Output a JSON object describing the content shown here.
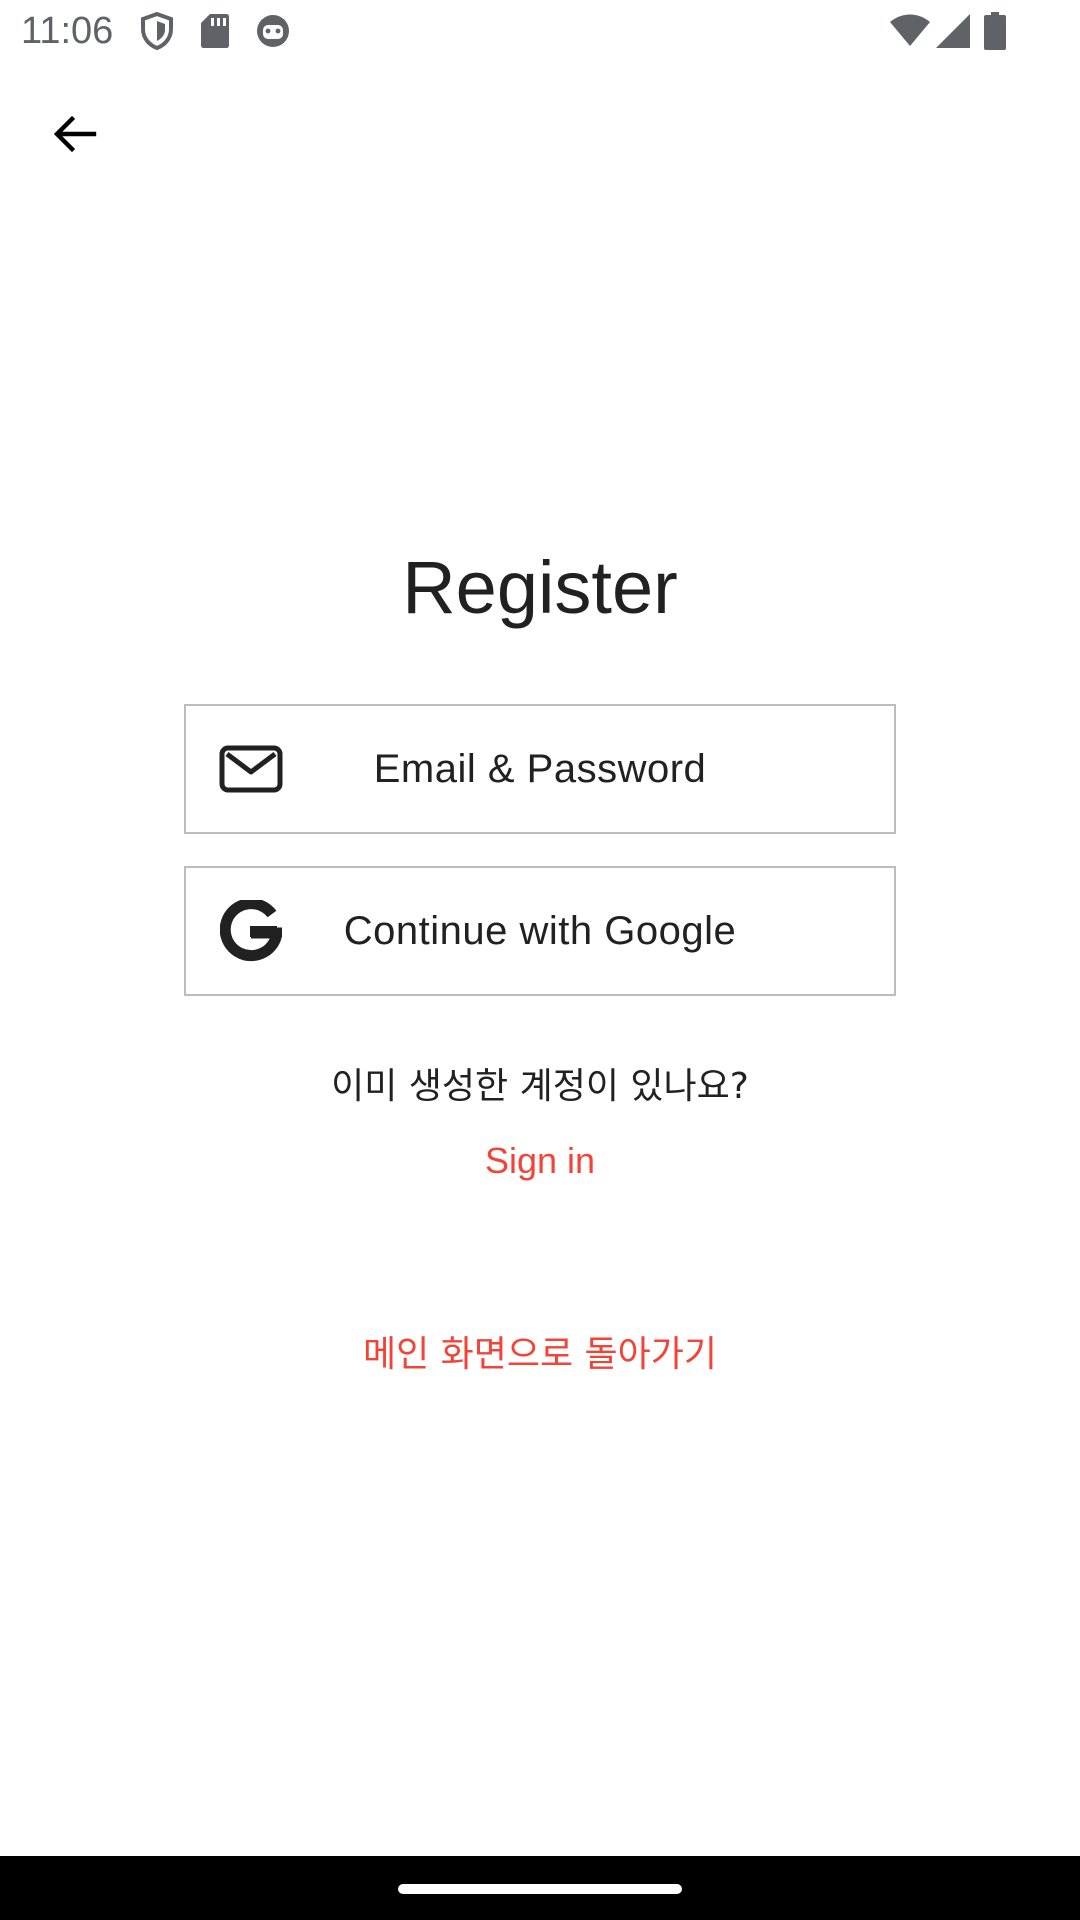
{
  "status_bar": {
    "time": "11:06",
    "icons": [
      "shield-icon",
      "sd-card-icon",
      "android-debug-icon",
      "wifi-icon",
      "cell-signal-icon",
      "battery-icon"
    ]
  },
  "app_bar": {
    "back_icon": "arrow-back-icon"
  },
  "main": {
    "title": "Register",
    "email_button_label": "Email & Password",
    "email_icon": "envelope-icon",
    "google_button_label": "Continue with Google",
    "google_icon": "google-icon",
    "existing_account_prompt": "이미 생성한 계정이 있나요?",
    "sign_in_label": "Sign in",
    "back_to_main_label": "메인 화면으로 돌아가기"
  },
  "colors": {
    "accent": "#f44336",
    "text": "#212121",
    "border": "#bdbdbd",
    "status_icons": "#5f6368"
  }
}
